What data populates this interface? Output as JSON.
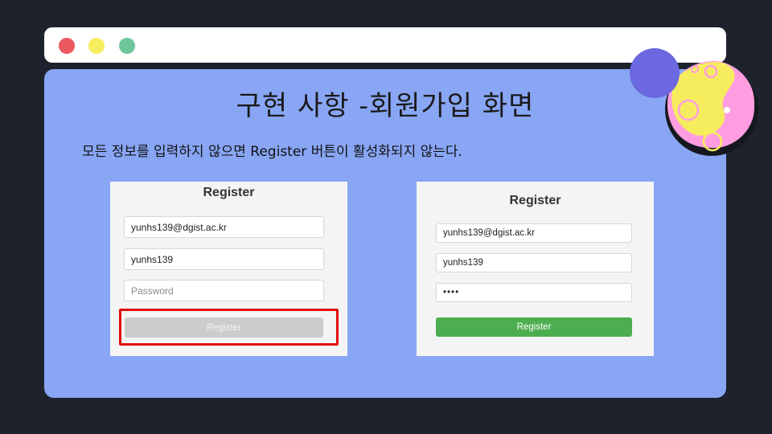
{
  "window": {
    "controls": [
      "close-dot",
      "minimize-dot",
      "maximize-dot"
    ]
  },
  "slide": {
    "title": "구현 사항 -회원가입 화면",
    "subtitle": "모든 정보를 입력하지 않으면 Register 버튼이 활성화되지 않는다."
  },
  "left_form": {
    "title": "Register",
    "email_value": "yunhs139@dgist.ac.kr",
    "username_value": "yunhs139",
    "password_placeholder": "Password",
    "button_label": "Register",
    "button_state": "disabled"
  },
  "right_form": {
    "title": "Register",
    "email_value": "yunhs139@dgist.ac.kr",
    "username_value": "yunhs139",
    "password_masked": "••••",
    "button_label": "Register",
    "button_state": "enabled"
  },
  "colors": {
    "background": "#1e222c",
    "panel": "#89a6f5",
    "disabled_button": "#cccccc",
    "active_button": "#4cae4f",
    "highlight_border": "#e30b0b"
  }
}
